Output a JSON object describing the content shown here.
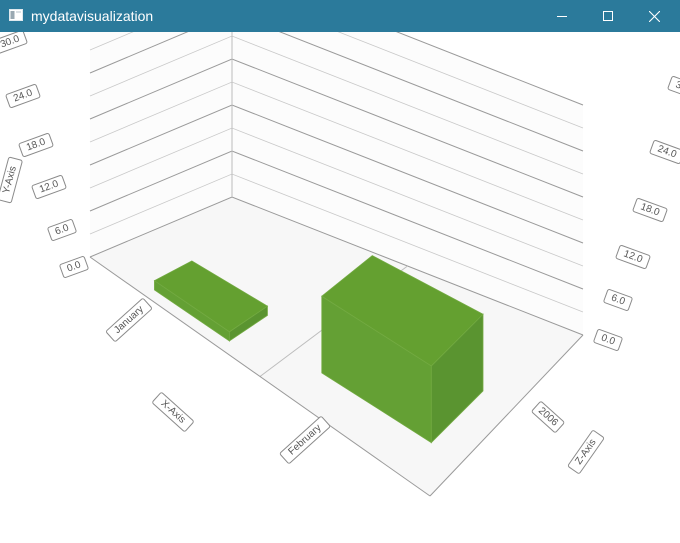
{
  "window": {
    "title": "mydatavisualization",
    "icon": "app-window-icon",
    "controls": {
      "minimize": "minimize-icon",
      "maximize": "maximize-icon",
      "close": "close-icon"
    }
  },
  "chart_data": {
    "type": "bar3d",
    "title": "",
    "x_axis": {
      "title": "X-Axis",
      "categories": [
        "January",
        "February"
      ]
    },
    "y_axis": {
      "title": "Y-Axis",
      "range": [
        0,
        30
      ],
      "ticks": [
        "0.0",
        "6.0",
        "12.0",
        "18.0",
        "24.0",
        "30.0"
      ]
    },
    "z_axis": {
      "title": "Z-Axis",
      "categories": [
        "2006"
      ]
    },
    "series": [
      {
        "values": [
          1.2,
          10.0
        ],
        "color": "#64a030"
      }
    ],
    "grid": true
  }
}
